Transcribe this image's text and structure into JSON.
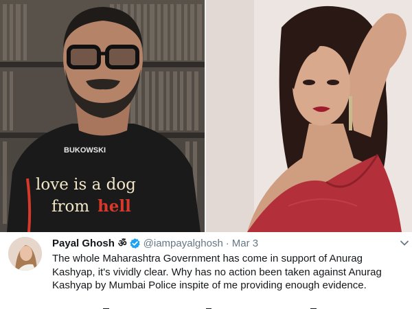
{
  "tweet": {
    "display_name": "Payal Ghosh",
    "name_glyph": "ॐ",
    "handle": "@iampayalghosh",
    "separator": "·",
    "date": "Mar 3",
    "text": "The whole Maharashtra Government has come in support of Anurag Kashyap, it's vividly clear. Why has no action been taken against Anurag Kashyap by Mumbai Police inspite of me providing enough evidence."
  },
  "images": {
    "left_shirt_brand": "BUKOWSKI",
    "left_shirt_line1": "love is a dog",
    "left_shirt_line2": "from",
    "left_shirt_line3": "hell"
  },
  "colors": {
    "verified": "#1da1f2",
    "handle_gray": "#657786",
    "text_dark": "#14171a",
    "dress_red": "#b3303a"
  },
  "icons": {
    "verified": "verified-badge-icon",
    "menu": "chevron-down-icon"
  }
}
